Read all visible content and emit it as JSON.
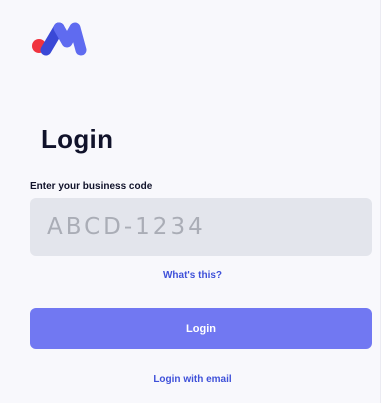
{
  "brand": {
    "logo_icon": "brand-m-logo-icon",
    "colors": {
      "dot": "#f0343f",
      "left_stroke": "#3a48d6",
      "right_stroke": "#5f6bf0"
    }
  },
  "login": {
    "title": "Login",
    "code_label": "Enter your business code",
    "code_value": "",
    "code_placeholder": "ABCD-1234",
    "whats_this": "What's this?",
    "submit_label": "Login",
    "email_link": "Login with email"
  },
  "colors": {
    "background": "#f8f8fc",
    "input_bg": "#e3e5ec",
    "button_bg": "#7178f2",
    "link": "#3f51d9",
    "title": "#10122a"
  }
}
